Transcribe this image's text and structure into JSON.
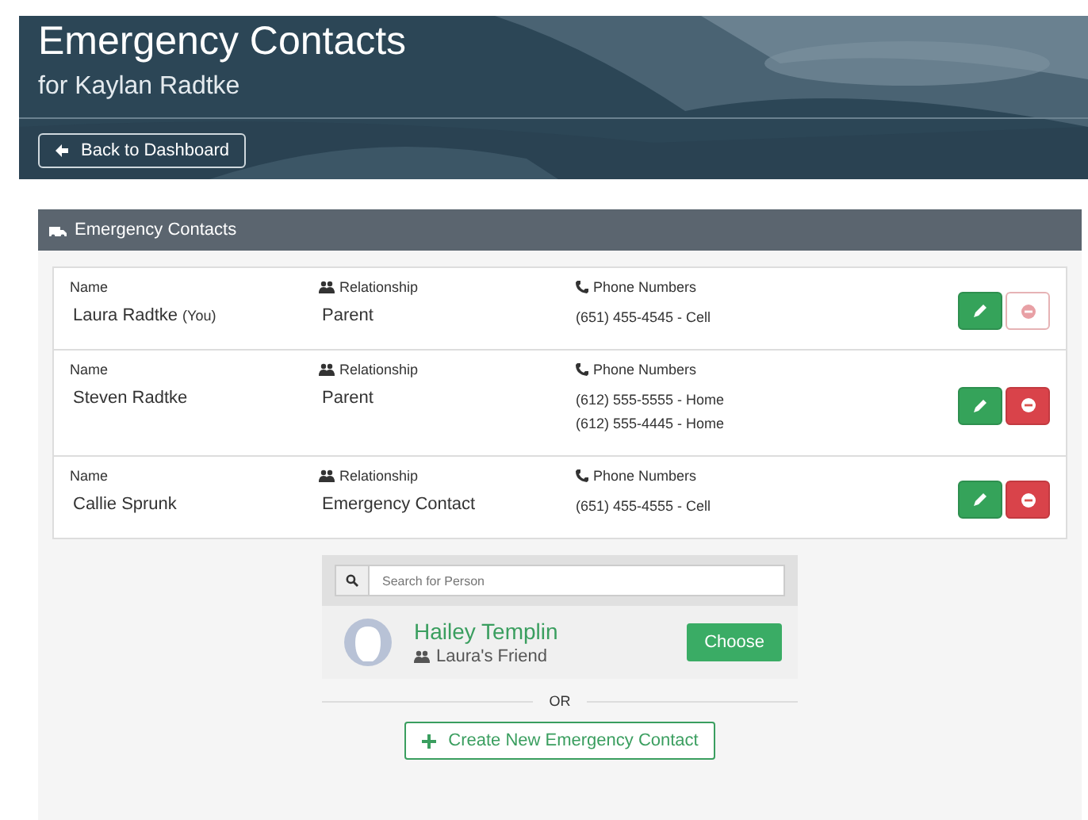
{
  "header": {
    "title": "Emergency Contacts",
    "subtitle": "for Kaylan Radtke",
    "back_button": "Back to Dashboard"
  },
  "panel": {
    "title": "Emergency Contacts",
    "contacts": [
      {
        "name_label": "Name",
        "name": "Laura Radtke",
        "name_tag": "(You)",
        "relationship_label": "Relationship",
        "relationship": "Parent",
        "phones_label": "Phone Numbers",
        "phones": [
          "(651) 455-4545 - Cell"
        ],
        "delete_disabled": true
      },
      {
        "name_label": "Name",
        "name": "Steven Radtke",
        "relationship_label": "Relationship",
        "relationship": "Parent",
        "phones_label": "Phone Numbers",
        "phones": [
          "(612) 555-5555 - Home",
          "(612) 555-4445 - Home"
        ],
        "delete_disabled": false
      },
      {
        "name_label": "Name",
        "name": "Callie Sprunk",
        "relationship_label": "Relationship",
        "relationship": "Emergency Contact",
        "phones_label": "Phone Numbers",
        "phones": [
          "(651) 455-4555 - Cell"
        ],
        "delete_disabled": false
      }
    ],
    "search": {
      "placeholder": "Search for Person"
    },
    "result": {
      "name": "Hailey Templin",
      "relation": "Laura's Friend",
      "button": "Choose"
    },
    "divider": "OR",
    "create_button": "Create New Emergency Contact"
  }
}
